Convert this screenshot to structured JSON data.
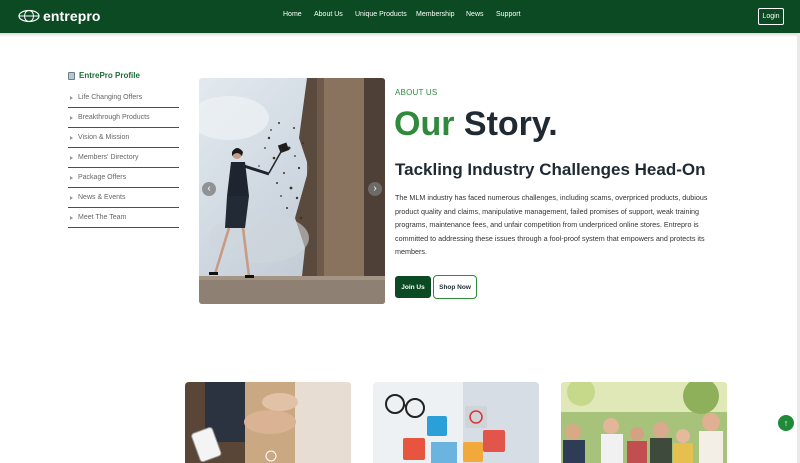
{
  "brand": {
    "name": "entrepro"
  },
  "nav": {
    "items": [
      {
        "label": "Home"
      },
      {
        "label": "About Us"
      },
      {
        "label": "Unique Products"
      },
      {
        "label": "Membership"
      },
      {
        "label": "News"
      },
      {
        "label": "Support"
      }
    ],
    "login_label": "Login"
  },
  "sidebar": {
    "title": "EntrePro Profile",
    "items": [
      {
        "label": "Life Changing Offers"
      },
      {
        "label": "Breakthrough Products"
      },
      {
        "label": "Vision & Mission"
      },
      {
        "label": "Members' Directory"
      },
      {
        "label": "Package Offers"
      },
      {
        "label": "News & Events"
      },
      {
        "label": "Meet The Team"
      }
    ]
  },
  "hero": {
    "prev_icon": "‹",
    "next_icon": "›"
  },
  "story": {
    "eyebrow": "ABOUT US",
    "title_accent": "Our",
    "title_rest": "Story.",
    "subtitle": "Tackling Industry Challenges Head-On",
    "body": "The MLM industry has faced numerous challenges, including scams, overpriced products, dubious product quality and claims, manipulative management, failed promises of support, weak training programs, maintenance fees, and unfair competition from underpriced online stores. Entrepro is committed to addressing these issues through a fool-proof system that empowers and protects its members.",
    "join_label": "Join Us",
    "shop_label": "Shop Now"
  },
  "scroll_top_icon": "↑",
  "colors": {
    "primary": "#0b4a22",
    "accent": "#2f8a3c",
    "heading": "#1f2a33"
  }
}
